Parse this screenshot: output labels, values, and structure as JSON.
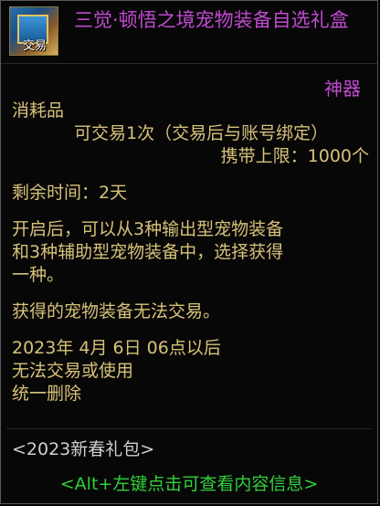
{
  "item": {
    "icon_label": "交易",
    "title": "三觉·顿悟之境宠物装备自选礼盒",
    "rarity": "神器",
    "type": "消耗品",
    "trade": "可交易1次（交易后与账号绑定）",
    "carry_limit": "携带上限：1000个",
    "remaining_time": "剩余时间：2天",
    "description_1": "开启后，可以从3种输出型宠物装备",
    "description_2": "和3种辅助型宠物装备中，选择获得",
    "description_3": "一种。",
    "warning": "获得的宠物装备无法交易。",
    "expiry_1": "2023年 4月 6日 06点以后",
    "expiry_2": "无法交易或使用",
    "expiry_3": "统一删除",
    "package": "<2023新春礼包>",
    "hint": "<Alt+左键点击可查看内容信息>"
  }
}
